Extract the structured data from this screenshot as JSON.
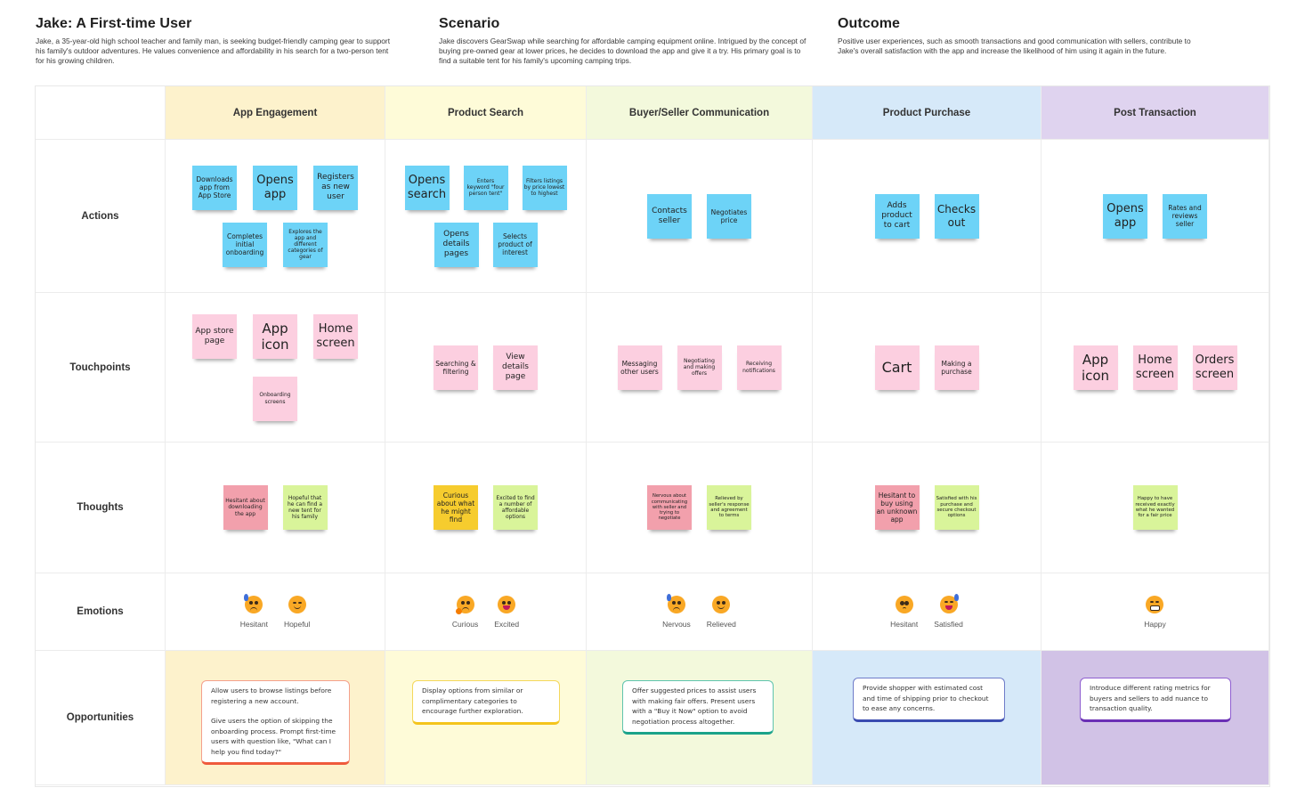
{
  "intro": {
    "persona": {
      "title": "Jake: A First-time User",
      "text": "Jake, a 35-year-old high school teacher and family man, is seeking budget-friendly camping gear to support his family's outdoor adventures. He values convenience and affordability in his search for a two-person tent for his growing children."
    },
    "scenario": {
      "title": "Scenario",
      "text": "Jake discovers GearSwap while searching for affordable camping equipment online. Intrigued by the concept of buying pre-owned gear at lower prices, he decides to download the app and give it a try. His primary goal is to find a suitable tent for his family's upcoming camping trips."
    },
    "outcome": {
      "title": "Outcome",
      "text": "Positive user experiences, such as smooth transactions and good communication with sellers, contribute to Jake's overall satisfaction with the app and increase the likelihood of him using it again in the future."
    }
  },
  "columns": [
    {
      "label": "App Engagement",
      "color": "#fdf2cc"
    },
    {
      "label": "Product Search",
      "color": "#fefbd8"
    },
    {
      "label": "Buyer/Seller Communication",
      "color": "#f3f9dc"
    },
    {
      "label": "Product Purchase",
      "color": "#d6e9f9"
    },
    {
      "label": "Post Transaction",
      "color": "#dfd3ef"
    }
  ],
  "rows": {
    "actions": "Actions",
    "touchpoints": "Touchpoints",
    "thoughts": "Thoughts",
    "emotions": "Emotions",
    "opportunities": "Opportunities"
  },
  "actions": [
    [
      "Downloads app from App Store",
      "Opens app",
      "Registers as new user",
      "Completes initial onboarding",
      "Explores the app and different categories of gear"
    ],
    [
      "Opens search",
      "Enters keyword \"four person tent\"",
      "Filters listings by price lowest to highest",
      "Opens details pages",
      "Selects product of interest"
    ],
    [
      "Contacts seller",
      "Negotiates price"
    ],
    [
      "Adds product to cart",
      "Checks out"
    ],
    [
      "Opens app",
      "Rates and reviews seller"
    ]
  ],
  "touchpoints": [
    [
      "App store page",
      "App icon",
      "Home screen",
      "Onboarding screens"
    ],
    [
      "Searching & filtering",
      "View details page"
    ],
    [
      "Messaging other users",
      "Negotiating and making offers",
      "Receiving notifications"
    ],
    [
      "Cart",
      "Making a purchase"
    ],
    [
      "App icon",
      "Home screen",
      "Orders screen"
    ]
  ],
  "thoughts": [
    [
      "Hesitant about downloading the app",
      "Hopeful that he can find a new tent for his family"
    ],
    [
      "Curious about what he might find",
      "Excited to find a number of affordable options"
    ],
    [
      "Nervous about communicating with seller and trying to negotiate",
      "Relieved by seller's response and agreement to terms"
    ],
    [
      "Hesitant to buy using an unknown app",
      "Satisfied with his purchase and secure checkout options"
    ],
    [
      "Happy to have received exactly what he wanted for a fair price"
    ]
  ],
  "emotions": [
    [
      {
        "label": "Hesitant",
        "icon": "anxious-sweat-face-icon"
      },
      {
        "label": "Hopeful",
        "icon": "smiling-blush-face-icon"
      }
    ],
    [
      {
        "label": "Curious",
        "icon": "thinking-face-icon"
      },
      {
        "label": "Excited",
        "icon": "grinning-face-icon"
      }
    ],
    [
      {
        "label": "Nervous",
        "icon": "anxious-sweat-face-icon"
      },
      {
        "label": "Relieved",
        "icon": "relieved-face-icon"
      }
    ],
    [
      {
        "label": "Hesitant",
        "icon": "pleading-face-icon"
      },
      {
        "label": "Satisfied",
        "icon": "grinning-sweat-face-icon"
      }
    ],
    [
      {
        "label": "Happy",
        "icon": "beaming-face-icon"
      }
    ]
  ],
  "opportunities": [
    [
      "Allow users to browse listings before registering a new account.",
      "Give users the option of skipping the onboarding process. Prompt first-time users with question like, \"What can I help you find today?\""
    ],
    [
      "Display options from similar or complimentary categories to encourage further exploration."
    ],
    [
      "Offer suggested prices to assist users with making fair offers. Present users with a \"Buy it Now\" option to avoid negotiation process altogether."
    ],
    [
      "Provide shopper with estimated cost and time of shipping prior to checkout to ease any concerns."
    ],
    [
      "Introduce different rating metrics for buyers and sellers to add nuance to transaction quality."
    ]
  ],
  "opportunity_colors": [
    "#ef5a3c",
    "#f4c41c",
    "#1aa38a",
    "#3a4bb0",
    "#6a2fb5"
  ]
}
